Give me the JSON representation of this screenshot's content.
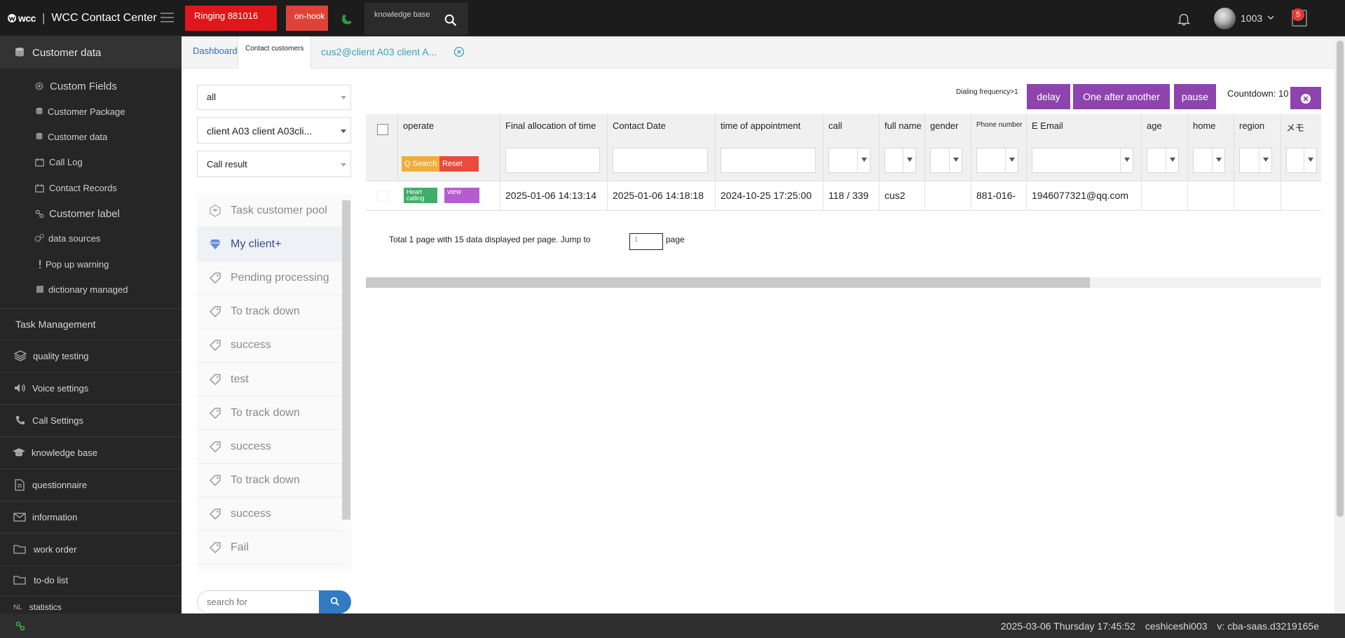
{
  "topbar": {
    "logo_mark": "wcc",
    "app_title": "WCC Contact Center",
    "ringing_label": "Ringing 881016",
    "onhook_label": "on-hook",
    "knowledge_base_label": "knowledge base",
    "user": "1003",
    "notification_count": "5"
  },
  "sidebar": {
    "items": [
      {
        "label": "Customer data",
        "icon": "database-icon"
      },
      {
        "label": "Custom Fields",
        "icon": "gear-icon"
      },
      {
        "label": "Customer Package",
        "icon": "database-icon"
      },
      {
        "label": "Customer data",
        "icon": "database-icon"
      },
      {
        "label": "Call Log",
        "icon": "log-icon"
      },
      {
        "label": "Contact Records",
        "icon": "record-icon"
      },
      {
        "label": "Customer label",
        "icon": "link-icon"
      },
      {
        "label": "data sources",
        "icon": "gears-icon"
      },
      {
        "label": "Pop up warning",
        "icon": "exclamation-icon"
      },
      {
        "label": "dictionary managed",
        "icon": "book-icon"
      },
      {
        "label": "Task Management",
        "icon": ""
      },
      {
        "label": "quality testing",
        "icon": "layers-icon"
      },
      {
        "label": "Voice settings",
        "icon": "speaker-icon"
      },
      {
        "label": "Call Settings",
        "icon": "phone-icon"
      },
      {
        "label": "knowledge base",
        "icon": "graduation-cap-icon"
      },
      {
        "label": "questionnaire",
        "icon": "document-icon"
      },
      {
        "label": "information",
        "icon": "envelope-icon"
      },
      {
        "label": "work order",
        "icon": "folder-icon"
      },
      {
        "label": "to-do list",
        "icon": "folder-icon"
      },
      {
        "label": "statistics",
        "icon": "NL"
      }
    ]
  },
  "tabs": {
    "dashboard": "Dashboard",
    "contact_customers": "Contact customers",
    "client": "cus2@client A03 client A..."
  },
  "filters": {
    "scope": "all",
    "client": "client A03 client A03cli...",
    "call_result": "Call result"
  },
  "task_list": [
    {
      "label": "Task customer pool",
      "icon": "hexagon-icon"
    },
    {
      "label": "My client+",
      "icon": "diamond-icon"
    },
    {
      "label": "Pending processing",
      "icon": "tag-icon"
    },
    {
      "label": "To track down",
      "icon": "tag-icon"
    },
    {
      "label": "success",
      "icon": "tag-icon"
    },
    {
      "label": "test",
      "icon": "tag-icon"
    },
    {
      "label": "To track down",
      "icon": "tag-icon"
    },
    {
      "label": "success",
      "icon": "tag-icon"
    },
    {
      "label": "To track down",
      "icon": "tag-icon"
    },
    {
      "label": "success",
      "icon": "tag-icon"
    },
    {
      "label": "Fail",
      "icon": "tag-icon"
    }
  ],
  "search": {
    "placeholder": "search for"
  },
  "toolbar": {
    "dialing_frequency": "Dialing frequency>1",
    "delay": "delay",
    "one_after_another": "One after another",
    "pause": "pause",
    "countdown": "Countdown: 10"
  },
  "table": {
    "columns": [
      "operate",
      "Final allocation of time",
      "Contact Date",
      "time of appointment",
      "call",
      "full name",
      "gender",
      "Phone number",
      "E Email",
      "age",
      "home",
      "region",
      "メモ"
    ],
    "search_btn": "Q Search",
    "reset_btn": "Reset",
    "rows": [
      {
        "heart_calling": "Heart calling",
        "view": "view",
        "final_allocation": "2025-01-06 14:13:14",
        "contact_date": "2025-01-06 14:18:18",
        "appointment": "2024-10-25 17:25:00",
        "call": "118 / 339",
        "full_name": "cus2",
        "gender": "",
        "phone": "881-016-",
        "email": "1946077321@qq.com",
        "age": "",
        "home": "",
        "region": "",
        "memo": ""
      }
    ],
    "pager": "Total 1 page with 15 data displayed per page. Jump to",
    "jump_value": "1",
    "page_word": "page"
  },
  "status": {
    "datetime": "2025-03-06 Thursday 17:45:52",
    "account": "ceshiceshi003",
    "version": "v: cba-saas.d3219165e"
  },
  "colors": {
    "topbar": "#1c1c1c",
    "sidebar": "#262626",
    "ringing": "#e0161a",
    "onhook": "#df4237",
    "accent_purple": "#8e44ad",
    "search_blue": "#2f7bc4",
    "tab_link": "#2a6fc0",
    "client_tab": "#3aa0b8"
  }
}
